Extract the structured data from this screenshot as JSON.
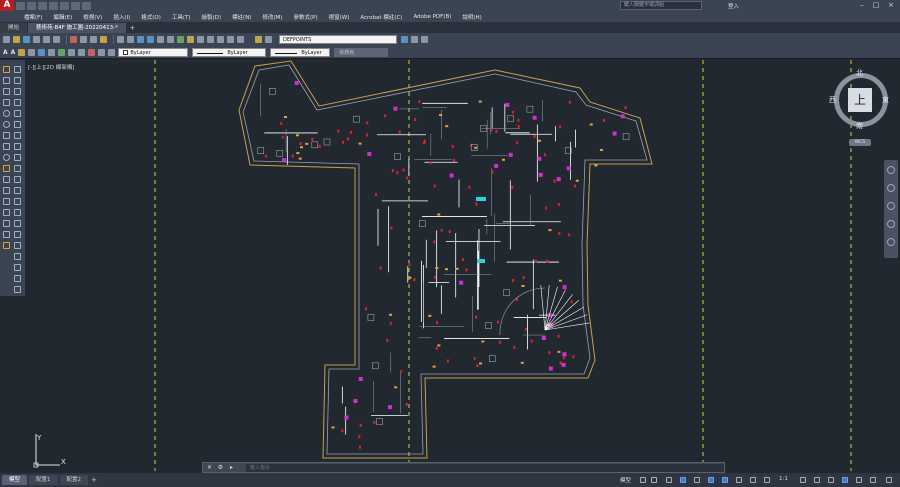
{
  "app": {
    "logo": "A",
    "title": "",
    "search_placeholder": "鍵入關鍵字或詞組",
    "signin": "登入"
  },
  "menu": [
    "檔案(F)",
    "編輯(E)",
    "檢視(V)",
    "插入(I)",
    "格式(O)",
    "工具(T)",
    "繪製(D)",
    "標註(N)",
    "修改(M)",
    "參數式(P)",
    "視窗(W)",
    "Acrobat 標註(C)",
    "Adobe PDF(B)",
    "說明(H)"
  ],
  "tabs": [
    {
      "label": "開始",
      "active": false
    },
    {
      "label": "藝術苑-B4F 施工圖-20220413-*",
      "active": true
    }
  ],
  "toolbar": {
    "layer_value": "DEFPOINTS",
    "text_a1": "A",
    "text_a2": "A",
    "color_value": "ByLayer",
    "linetype_value": "ByLayer",
    "lineweight_value": "ByLayer",
    "plotstyle_value": "依顏色"
  },
  "viewport_label": "[-][上][2D 線架構]",
  "viewcube": {
    "face": "上",
    "north": "北",
    "south": "南",
    "east": "東",
    "west": "西",
    "wcs": "WCS"
  },
  "ucs": {
    "x": "X",
    "y": "Y"
  },
  "command": {
    "placeholder": "鍵入指令"
  },
  "layouts": [
    {
      "label": "模型",
      "active": true
    },
    {
      "label": "配置1",
      "active": false
    },
    {
      "label": "配置2",
      "active": false
    }
  ],
  "status": {
    "model": "模型",
    "scale": "1:1"
  },
  "colors": {
    "background": "#212830",
    "wall": "#9aa3ad",
    "boundary": "#c8a14a",
    "pipe": "#ffffff",
    "fitting": "#e0202a",
    "device": "#d22fd0",
    "tag": "#e9a23b",
    "grid_axis": "#d8d23a",
    "highlight": "#2fd0d8"
  }
}
